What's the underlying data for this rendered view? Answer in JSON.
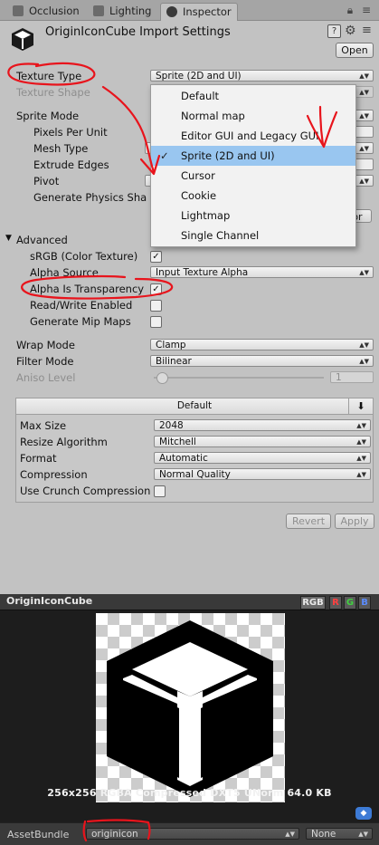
{
  "tabs": [
    {
      "label": "Occlusion",
      "active": false
    },
    {
      "label": "Lighting",
      "active": false
    },
    {
      "label": "Inspector",
      "active": true
    }
  ],
  "header": {
    "title": "OriginIconCube Import Settings",
    "open_label": "Open"
  },
  "fields": {
    "texture_type": {
      "label": "Texture Type",
      "value": "Sprite (2D and UI)"
    },
    "texture_shape": {
      "label": "Texture Shape"
    },
    "sprite_mode": {
      "label": "Sprite Mode"
    },
    "pixels_per_unit": {
      "label": "Pixels Per Unit"
    },
    "mesh_type": {
      "label": "Mesh Type"
    },
    "extrude_edges": {
      "label": "Extrude Edges"
    },
    "pivot": {
      "label": "Pivot"
    },
    "generate_physics_shape": {
      "label": "Generate Physics Sha"
    },
    "editor_button_partial": "tor",
    "advanced": {
      "label": "Advanced"
    },
    "srgb": {
      "label": "sRGB (Color Texture)",
      "checked": true
    },
    "alpha_source": {
      "label": "Alpha Source",
      "value": "Input Texture Alpha"
    },
    "alpha_is_transparency": {
      "label": "Alpha Is Transparency",
      "checked": true
    },
    "read_write": {
      "label": "Read/Write Enabled",
      "checked": false
    },
    "generate_mip_maps": {
      "label": "Generate Mip Maps",
      "checked": false
    },
    "wrap_mode": {
      "label": "Wrap Mode",
      "value": "Clamp"
    },
    "filter_mode": {
      "label": "Filter Mode",
      "value": "Bilinear"
    },
    "aniso_level": {
      "label": "Aniso Level",
      "value": "1"
    }
  },
  "texture_type_menu": {
    "options": [
      "Default",
      "Normal map",
      "Editor GUI and Legacy GUI",
      "Sprite (2D and UI)",
      "Cursor",
      "Cookie",
      "Lightmap",
      "Single Channel"
    ],
    "selected": "Sprite (2D and UI)"
  },
  "platform": {
    "tab_label": "Default",
    "max_size": {
      "label": "Max Size",
      "value": "2048"
    },
    "resize_algorithm": {
      "label": "Resize Algorithm",
      "value": "Mitchell"
    },
    "format": {
      "label": "Format",
      "value": "Automatic"
    },
    "compression": {
      "label": "Compression",
      "value": "Normal Quality"
    },
    "use_crunch": {
      "label": "Use Crunch Compression",
      "checked": false
    }
  },
  "buttons": {
    "revert": "Revert",
    "apply": "Apply"
  },
  "preview": {
    "title": "OriginIconCube",
    "channels": [
      "RGB",
      "R",
      "G",
      "B"
    ],
    "info": "256x256  RGBA Compressed DXT5 UNorm   64.0 KB"
  },
  "asset_bundle": {
    "label": "AssetBundle",
    "name": "originicon",
    "variant": "None"
  },
  "glyphs": {
    "check": "✓",
    "help": "?",
    "gear": "⚙",
    "hmenu": "≡",
    "arrow": "▲▼",
    "triangle_down": "▼",
    "download": "⬇",
    "tag": "◆"
  },
  "colors": {
    "menu_highlight": "#99c6f0",
    "annotation_red": "#e8141c",
    "tag_blue": "#3d7bd6"
  }
}
